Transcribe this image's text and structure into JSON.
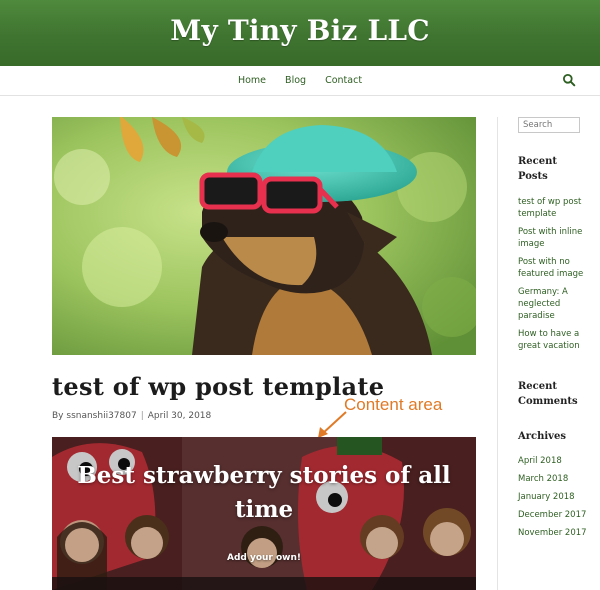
{
  "site": {
    "title": "My Tiny Biz LLC"
  },
  "nav": {
    "items": [
      "Home",
      "Blog",
      "Contact"
    ]
  },
  "post": {
    "title": "test of wp post template",
    "author": "ssnanshii37807",
    "separator": "|",
    "date": "April 30, 2018"
  },
  "annotation": {
    "label": "Content area",
    "color": "#e07a26"
  },
  "hero": {
    "heading": "Best strawberry stories of all time",
    "subheading": "Add your own!"
  },
  "sidebar": {
    "search_placeholder": "Search",
    "recent_posts": {
      "title": "Recent Posts",
      "items": [
        "test of wp post template",
        "Post with inline image",
        "Post with no featured image",
        "Germany: A neglected paradise",
        "How to have a great vacation"
      ]
    },
    "recent_comments": {
      "title": "Recent Comments"
    },
    "archives": {
      "title": "Archives",
      "items": [
        "April 2018",
        "March 2018",
        "January 2018",
        "December 2017",
        "November 2017"
      ]
    }
  },
  "colors": {
    "header_green": "#3f7430",
    "link_green": "#2e5f22",
    "annotation_orange": "#e07a26"
  },
  "icons": {
    "nav_search": "search-icon"
  }
}
